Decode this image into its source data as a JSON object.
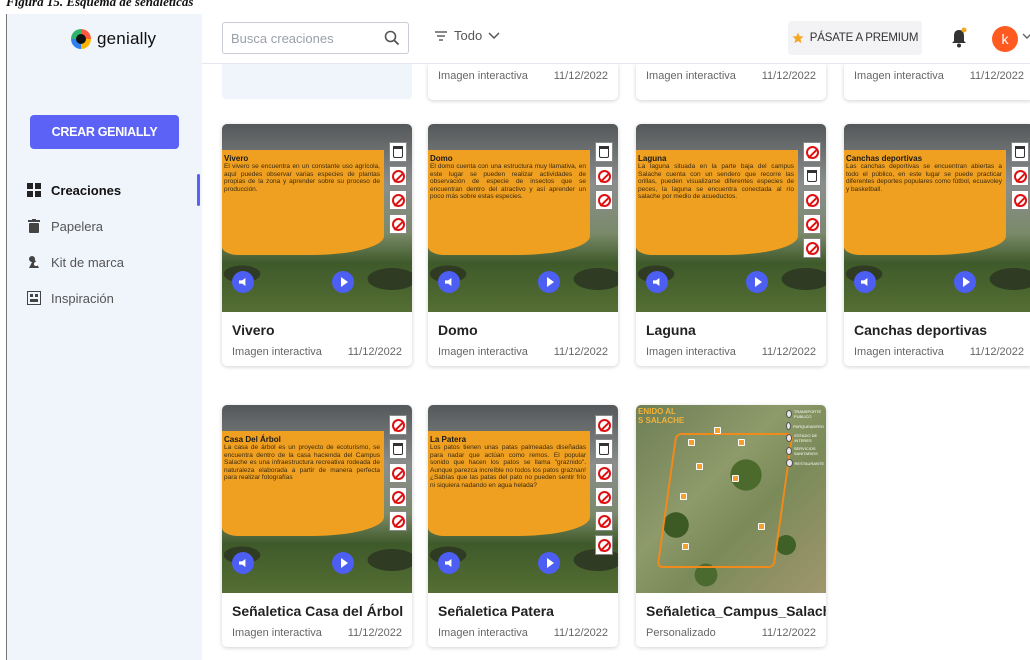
{
  "caption": "Figura 15. Esquema de señaléticas",
  "app": {
    "logo_text": "genially",
    "create_label": "CREAR GENIALLY",
    "avatar_letter": "k"
  },
  "sidebar": {
    "items": [
      {
        "label": "Creaciones",
        "icon": "grid-icon",
        "active": true
      },
      {
        "label": "Papelera",
        "icon": "trash-icon",
        "active": false
      },
      {
        "label": "Kit de marca",
        "icon": "brand-kit-icon",
        "active": false
      },
      {
        "label": "Inspiración",
        "icon": "inspiration-icon",
        "active": false
      }
    ]
  },
  "topbar": {
    "search_placeholder": "Busca creaciones",
    "filter_label": "Todo",
    "premium_label": "PÁSATE A PREMIUM"
  },
  "top_row": [
    {
      "type": "Imagen interactiva",
      "date": "11/12/2022"
    },
    {
      "type": "Imagen interactiva",
      "date": "11/12/2022"
    },
    {
      "type": "Imagen interactiva",
      "date": "11/12/2022"
    }
  ],
  "cards": [
    {
      "title": "Vivero",
      "type": "Imagen interactiva",
      "date": "11/12/2022",
      "banner_title": "Vivero",
      "banner_text": "El vivero se encuentra en un constante uso agrícola, aquí puedes observar varias especies de plantas propias de la zona y aprender sobre su proceso de producción."
    },
    {
      "title": "Domo",
      "type": "Imagen interactiva",
      "date": "11/12/2022",
      "banner_title": "Domo",
      "banner_text": "El domo cuenta con una estructura muy llamativa, en este lugar se pueden realizar actividades de observación de especie de insectos que se encuentran dentro del atractivo y así aprender un poco más sobre estas especies."
    },
    {
      "title": "Laguna",
      "type": "Imagen interactiva",
      "date": "11/12/2022",
      "banner_title": "Laguna",
      "banner_text": "La laguna situada en la parte baja del campus Salache cuenta con un sendero que recorre las orillas, pueden visualizarse diferentes especies de peces, la laguna se encuentra conectada al río salache por medio de acueductos."
    },
    {
      "title": "Canchas deportivas",
      "type": "Imagen interactiva",
      "date": "11/12/2022",
      "banner_title": "Canchas deportivas",
      "banner_text": "Las canchas deportivas se encuentran abiertas a todo el público, en este lugar se puede practicar diferentes deportes populares como fútbol, ecuavoley y basketball."
    },
    {
      "title": "Señaletica Casa del Árbol",
      "type": "Imagen interactiva",
      "date": "11/12/2022",
      "banner_title": "Casa Del Árbol",
      "banner_text": "La casa de árbol es un proyecto de ecoturismo, se encuentra dentro de la casa hacienda del Campus Salache es una infraestructura recreativa rodeada de naturaleza elaborada a partir de manera perfecta para realizar fotografías"
    },
    {
      "title": "Señaletica Patera",
      "type": "Imagen interactiva",
      "date": "11/12/2022",
      "banner_title": "La Patera",
      "banner_text": "Los patos tienen unas patas palmeadas diseñadas para nadar que actúan como remos. El popular sonido que hacen los patos se llama \"graznido\". Aunque parezca increíble no todos los patos graznan! ¿Sabías que las patas del pato no pueden sentir frío ni siquiera nadando en agua helada?"
    },
    {
      "title": "Señaletica_Campus_Salache",
      "type": "Personalizado",
      "date": "11/12/2022",
      "map_title": "ENIDO AL\nS SALACHE",
      "legend": [
        "TRANSPORTE PUBLICO",
        "PARQUEADERO",
        "ESTADO DE INTERES",
        "SERVICIOS SANITARIOS",
        "RESTAURANTE"
      ]
    }
  ],
  "colors": {
    "accent": "#5b62f5",
    "banner": "#f0a020",
    "avatar": "#ff5a1f"
  }
}
